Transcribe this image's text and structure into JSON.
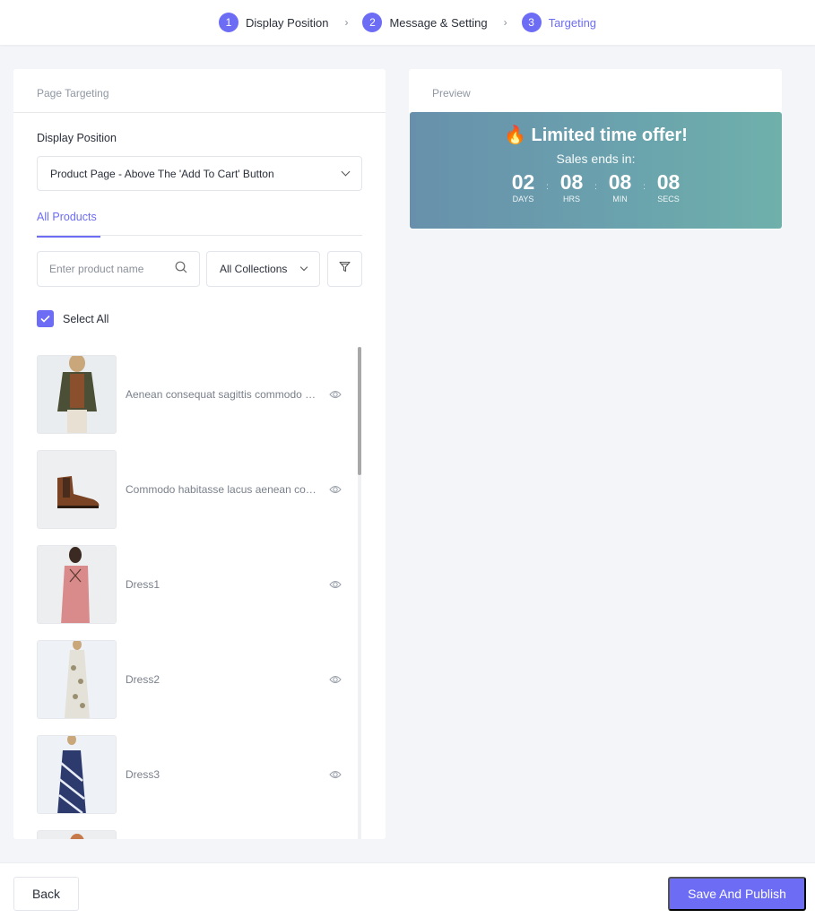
{
  "stepper": {
    "steps": [
      {
        "number": "1",
        "label": "Display Position",
        "active": false
      },
      {
        "number": "2",
        "label": "Message & Setting",
        "active": false
      },
      {
        "number": "3",
        "label": "Targeting",
        "active": true
      }
    ],
    "separator": "›"
  },
  "targeting": {
    "header": "Page Targeting",
    "display_position_label": "Display Position",
    "display_position_value": "Product Page - Above The 'Add To Cart' Button",
    "tab": "All Products",
    "search_placeholder": "Enter product name",
    "collection_value": "All Collections",
    "select_all_label": "Select All",
    "select_all_checked": true,
    "products": [
      {
        "name": "Aenean consequat sagittis commodo nunc",
        "image": "woman-olive-jacket"
      },
      {
        "name": "Commodo habitasse lacus aenean consequat",
        "image": "brown-chelsea-boot"
      },
      {
        "name": "Dress1",
        "image": "pink-dress"
      },
      {
        "name": "Dress2",
        "image": "floral-white-dress"
      },
      {
        "name": "Dress3",
        "image": "navy-tie-dye-dress"
      },
      {
        "name": "",
        "image": "partially-visible-product"
      }
    ]
  },
  "preview": {
    "header": "Preview",
    "title_emoji": "🔥",
    "title": "Limited time offer!",
    "subtitle": "Sales ends in:",
    "countdown": [
      {
        "value": "02",
        "label": "DAYS"
      },
      {
        "value": "08",
        "label": "HRS"
      },
      {
        "value": "08",
        "label": "MIN"
      },
      {
        "value": "08",
        "label": "SECS"
      }
    ],
    "separator": ":"
  },
  "footer": {
    "back_label": "Back",
    "save_label": "Save And Publish"
  },
  "colors": {
    "accent": "#6c6cf5",
    "banner_start": "#6890ac",
    "banner_end": "#6fb0ab"
  }
}
